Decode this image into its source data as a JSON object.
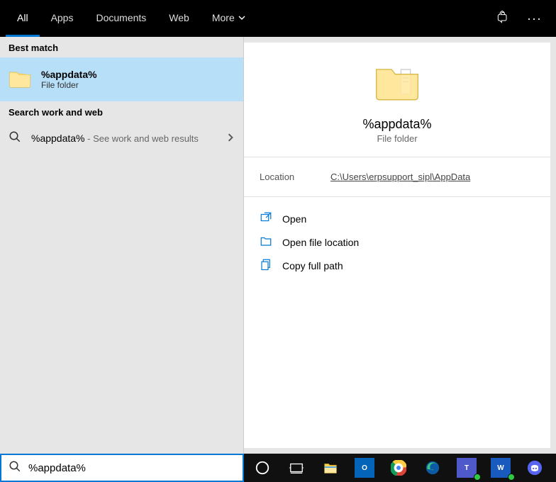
{
  "topbar": {
    "tabs": [
      "All",
      "Apps",
      "Documents",
      "Web",
      "More"
    ]
  },
  "left": {
    "best_label": "Best match",
    "best_title": "%appdata%",
    "best_sub": "File folder",
    "webwork_label": "Search work and web",
    "web_query": "%appdata%",
    "web_hint": " - See work and web results"
  },
  "preview": {
    "title": "%appdata%",
    "sub": "File folder",
    "loc_label": "Location",
    "loc_path": "C:\\Users\\erpsupport_sipl\\AppData",
    "actions": {
      "open": "Open",
      "open_loc": "Open file location",
      "copy": "Copy full path"
    }
  },
  "search": {
    "value": "%appdata%"
  }
}
